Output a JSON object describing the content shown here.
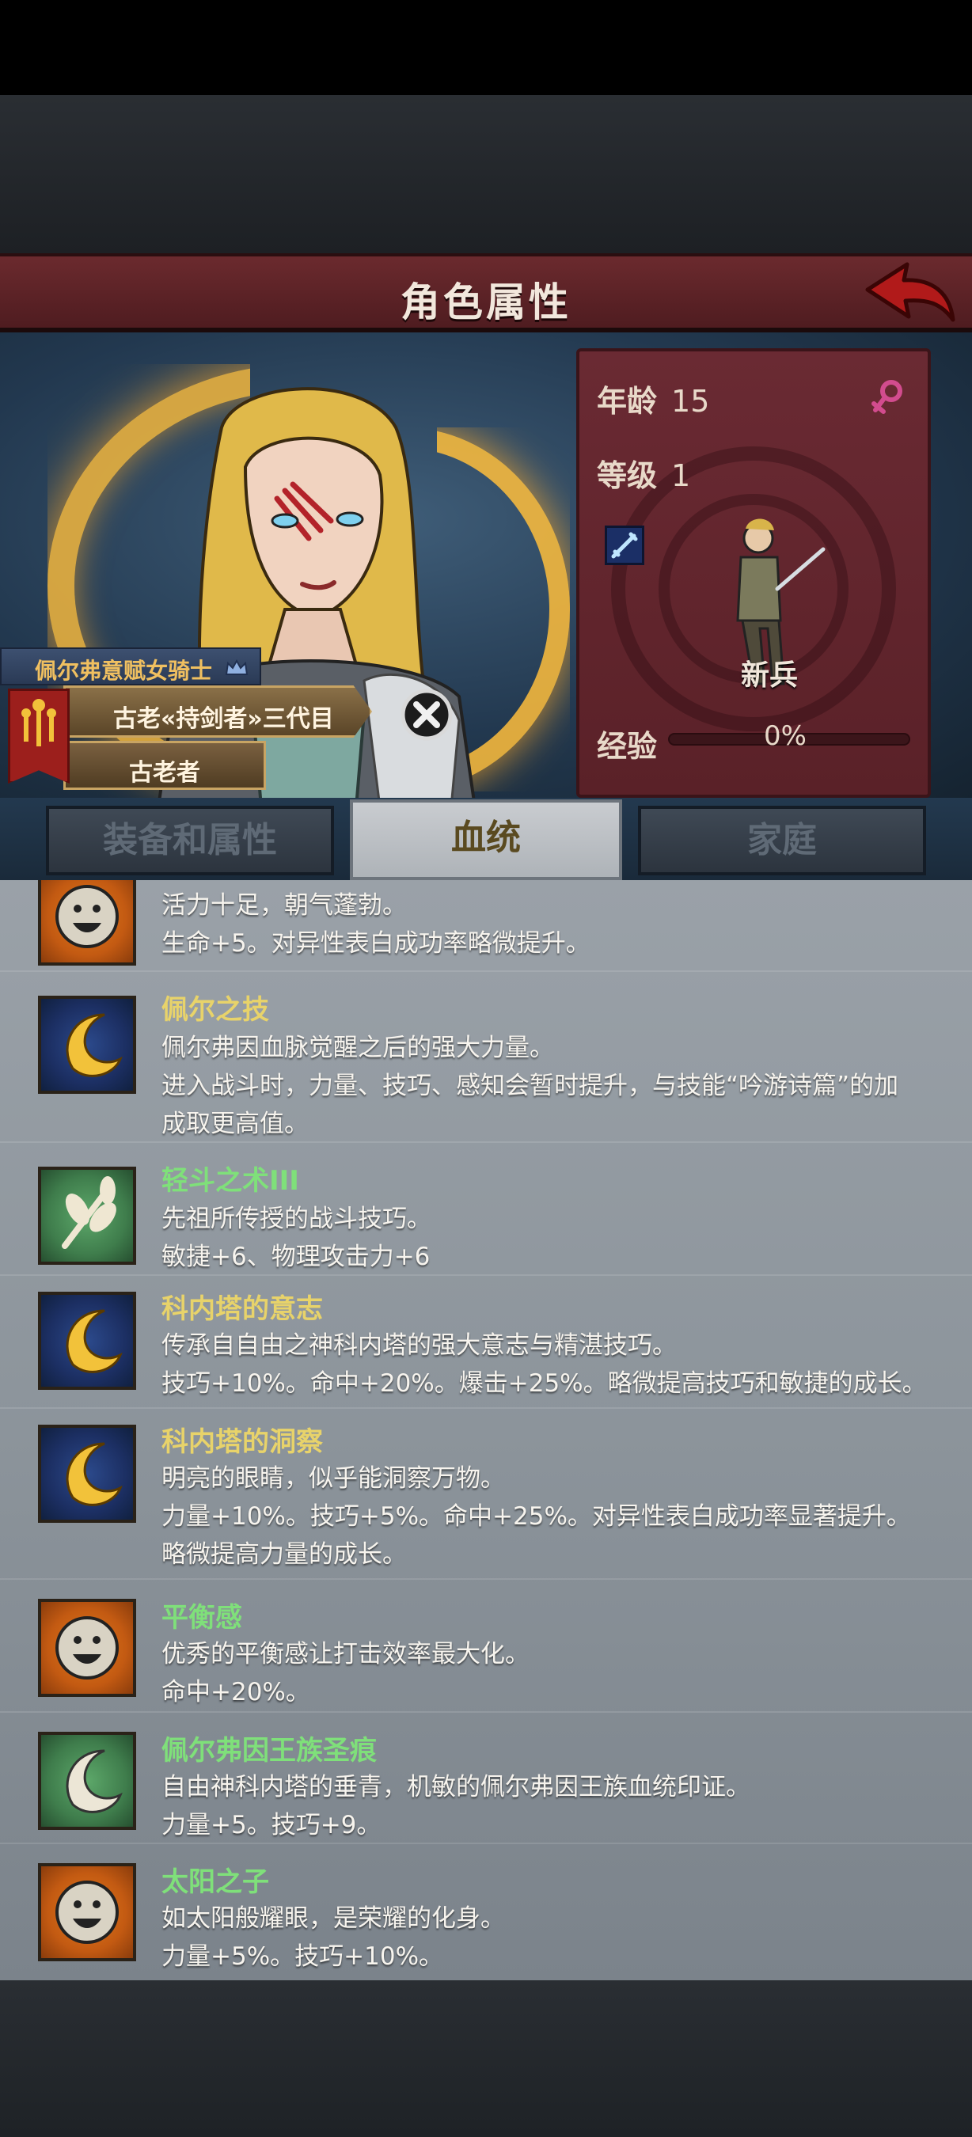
{
  "screen_title": "角色属性",
  "character": {
    "title": "佩尔弗意赋女骑士",
    "lineage": "古老«持剑者»三代目",
    "rank": "古老者"
  },
  "stats": {
    "age_label": "年龄",
    "age_value": "15",
    "level_label": "等级",
    "level_value": "1",
    "class_name": "新兵",
    "exp_label": "经验",
    "exp_value": "0%",
    "exp_progress": 0
  },
  "tabs": [
    {
      "label": "装备和属性",
      "active": false
    },
    {
      "label": "血统",
      "active": true
    },
    {
      "label": "家庭",
      "active": false
    }
  ],
  "traits": [
    {
      "icon": "smiley-icon",
      "name": "",
      "lines": [
        "活力十足，朝气蓬勃。",
        "生命+5。对异性表白成功率略微提升。"
      ]
    },
    {
      "icon": "crescent-moon-icon",
      "name": "佩尔之技",
      "name_color": "#e8d36a",
      "lines": [
        "佩尔弗因血脉觉醒之后的强大力量。",
        "进入战斗时，力量、技巧、感知会暂时提升，与技能“吟游诗篇”的加",
        "成取更高值。"
      ]
    },
    {
      "icon": "leaf-sprig-icon",
      "name": "轻斗之术III",
      "name_color": "#7fe07a",
      "lines": [
        "先祖所传授的战斗技巧。",
        "敏捷+6、物理攻击力+6"
      ]
    },
    {
      "icon": "crescent-moon-icon",
      "name": "科内塔的意志",
      "name_color": "#e8d36a",
      "lines": [
        "传承自自由之神科内塔的强大意志与精湛技巧。",
        "技巧+10%。命中+20%。爆击+25%。略微提高技巧和敏捷的成长。"
      ]
    },
    {
      "icon": "crescent-moon-icon",
      "name": "科内塔的洞察",
      "name_color": "#e8d36a",
      "lines": [
        "明亮的眼睛，似乎能洞察万物。",
        "力量+10%。技巧+5%。命中+25%。对异性表白成功率显著提升。",
        "略微提高力量的成长。"
      ]
    },
    {
      "icon": "smiley-icon",
      "name": "平衡感",
      "name_color": "#7fe07a",
      "lines": [
        "优秀的平衡感让打击效率最大化。",
        "命中+20%。"
      ]
    },
    {
      "icon": "white-crescent-icon",
      "name": "佩尔弗因王族圣痕",
      "name_color": "#7fe07a",
      "lines": [
        "自由神科内塔的垂青，机敏的佩尔弗因王族血统印证。",
        "力量+5。技巧+9。"
      ]
    },
    {
      "icon": "smiley-icon",
      "name": "太阳之子",
      "name_color": "#7fe07a",
      "lines": [
        "如太阳般耀眼，是荣耀的化身。",
        "力量+5%。技巧+10%。"
      ]
    }
  ],
  "colors": {
    "banner": "#5a2128",
    "stats_panel": "#6a2a33",
    "gold": "#f0c060",
    "trait_green": "#7fe07a",
    "trait_yellow": "#e8d36a"
  }
}
